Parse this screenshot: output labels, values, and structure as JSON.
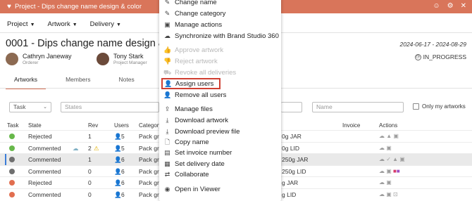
{
  "window": {
    "title": "Project - Dips change name design & color"
  },
  "menubar": {
    "items": [
      "Project",
      "Artwork",
      "Delivery"
    ]
  },
  "header": {
    "title": "0001 - Dips change name design & co",
    "dates": "2024-06-17 - 2024-08-29",
    "status": "IN_PROGRESS",
    "people": [
      {
        "name": "Cathryn Janeway",
        "role": "Orderer"
      },
      {
        "name": "Tony Stark",
        "role": "Project Manager"
      }
    ]
  },
  "tabs": [
    "Artworks",
    "Members",
    "Notes"
  ],
  "filters": {
    "task": "Task",
    "states": "States",
    "name_placeholder": "Name",
    "only_my_artworks": "Only my artworks"
  },
  "table": {
    "columns": [
      "Task",
      "State",
      "Rev",
      "Users",
      "Category",
      "Invoice",
      "Actions"
    ],
    "rows": [
      {
        "state": "Rejected",
        "rev": "1",
        "users": "5",
        "category": "Pack gr",
        "name": "0g JAR",
        "dot": "#67b84a"
      },
      {
        "state": "Commented",
        "rev": "2",
        "users": "5",
        "category": "Pack gr",
        "name": "0g LID",
        "dot": "#67b84a"
      },
      {
        "state": "Commented",
        "rev": "1",
        "users": "6",
        "category": "Pack gr",
        "name": "250g JAR",
        "dot": "#6f6f6f"
      },
      {
        "state": "Commented",
        "rev": "0",
        "users": "6",
        "category": "Pack gr",
        "name": "250g LID",
        "dot": "#6f6f6f"
      },
      {
        "state": "Rejected",
        "rev": "0",
        "users": "6",
        "category": "Pack gr",
        "name": "g JAR",
        "dot": "#e16e4f"
      },
      {
        "state": "Commented",
        "rev": "0",
        "users": "6",
        "category": "Pack gr",
        "name": "g LID",
        "dot": "#e16e4f"
      }
    ]
  },
  "context_menu": {
    "items": [
      {
        "label": "Change name",
        "icon": "pencil-icon",
        "disabled": false
      },
      {
        "label": "Change category",
        "icon": "pencil-icon",
        "disabled": false
      },
      {
        "label": "Manage actions",
        "icon": "actions-icon",
        "disabled": false
      },
      {
        "label": "Synchronize with Brand Studio 360",
        "icon": "cloud-icon",
        "disabled": false
      },
      {
        "label": "Approve artwork",
        "icon": "thumbs-up-icon",
        "disabled": true
      },
      {
        "label": "Reject artwork",
        "icon": "thumbs-down-icon",
        "disabled": true
      },
      {
        "label": "Revoke all deliveries",
        "icon": "truck-icon",
        "disabled": true
      },
      {
        "label": "Assign users",
        "icon": "user-plus-icon",
        "disabled": false
      },
      {
        "label": "Remove all users",
        "icon": "user-minus-icon",
        "disabled": false
      },
      {
        "label": "Manage files",
        "icon": "upload-icon",
        "disabled": false
      },
      {
        "label": "Download artwork",
        "icon": "download-icon",
        "disabled": false
      },
      {
        "label": "Download preview file",
        "icon": "download-icon",
        "disabled": false
      },
      {
        "label": "Copy name",
        "icon": "file-icon",
        "disabled": false
      },
      {
        "label": "Set invoice number",
        "icon": "document-icon",
        "disabled": false
      },
      {
        "label": "Set delivery date",
        "icon": "calendar-icon",
        "disabled": false
      },
      {
        "label": "Collaborate",
        "icon": "share-icon",
        "disabled": false
      },
      {
        "label": "Open in Viewer",
        "icon": "eye-icon",
        "disabled": false
      }
    ]
  },
  "colors": {
    "accent": "#d9755a",
    "highlight_border": "#cf3f32"
  }
}
